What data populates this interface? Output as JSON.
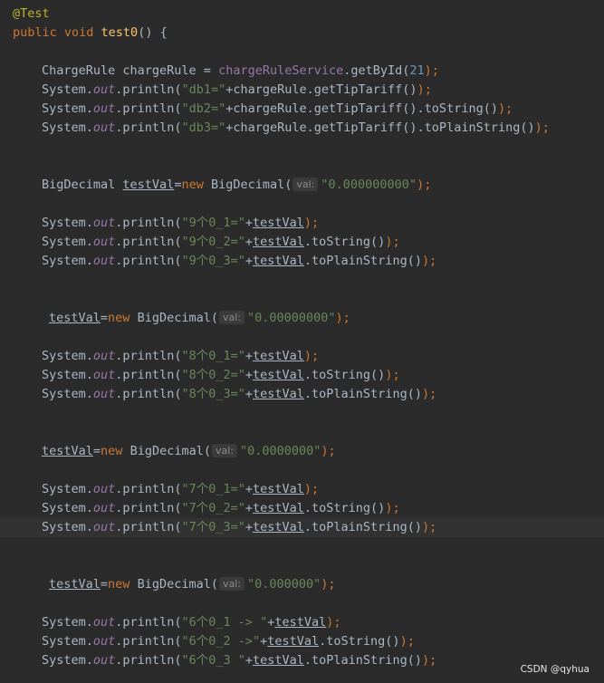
{
  "editor": {
    "annotation": "@Test",
    "method_kw": "public void",
    "method_name": "test0",
    "method_tail": "() {",
    "line_charge_type": "ChargeRule chargeRule = ",
    "line_charge_service": "chargeRuleService",
    "line_charge_call": ".getById(",
    "line_charge_id": "21",
    "line_charge_end": ");",
    "sys": "System.",
    "out": "out",
    "println_open": ".println(",
    "db1_str": "\"db1=\"",
    "db1_rest": "+chargeRule.getTipTariff()",
    "db2_str": "\"db2=\"",
    "db2_rest": "+chargeRule.getTipTariff().toString()",
    "db3_str": "\"db3=\"",
    "db3_rest": "+chargeRule.getTipTariff().toPlainString()",
    "close": ");",
    "decl_type": "BigDecimal ",
    "var": "testVal",
    "assign_new": "=new ",
    "new_kw": "new",
    "bigdecimal_open": "BigDecimal(",
    "hint_label": "val:",
    "val9": "\"0.000000000\"",
    "val8": "\"0.00000000\"",
    "val7": "\"0.0000000\"",
    "val6": "\"0.000000\"",
    "s9_1": "\"9个0_1=\"",
    "s9_2": "\"9个0_2=\"",
    "s9_3": "\"9个0_3=\"",
    "s8_1": "\"8个0_1=\"",
    "s8_2": "\"8个0_2=\"",
    "s8_3": "\"8个0_3=\"",
    "s7_1": "\"7个0_1=\"",
    "s7_2": "\"7个0_2=\"",
    "s7_3": "\"7个0_3=\"",
    "s6_1": "\"6个0_1 -> \"",
    "s6_2": "\"6个0_2 ->\"",
    "s6_3": "\"6个0_3 \"",
    "plus": "+",
    "to_string": ".toString()",
    "to_plain": ".toPlainString()"
  },
  "watermark": "CSDN @qyhua",
  "colors": {
    "background": "#2b2b2b",
    "keyword": "#cc7832",
    "string": "#6a8759",
    "number": "#6897bb",
    "function": "#ffc66d",
    "field": "#9876aa",
    "annotation": "#bbb529"
  }
}
